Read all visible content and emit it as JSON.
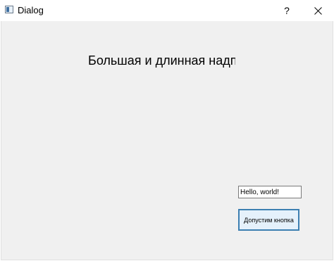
{
  "window": {
    "title": "Dialog",
    "help_label": "?",
    "icon": "app-window-icon"
  },
  "dialog": {
    "label_text": "Большая и длинная надпись",
    "line_edit_value": "Hello, world!",
    "button_label": "Допустим кнопка"
  },
  "colors": {
    "client_background": "#f0f0f0",
    "button_border": "#3c7fb1",
    "button_background": "#e5f1fb"
  }
}
